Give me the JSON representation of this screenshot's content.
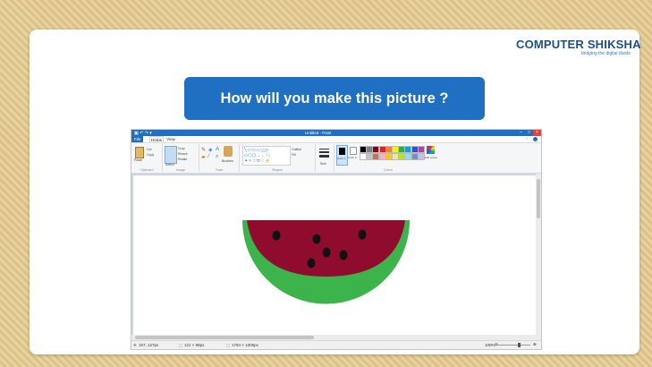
{
  "logo": {
    "main_a": "COMPUTER",
    "main_b": "SHIKSHA",
    "tagline": "bridging the digital divide"
  },
  "banner": {
    "question": "How will you make this picture ?"
  },
  "paint": {
    "title": "Untitled - Paint",
    "tabs": [
      "File",
      "Home",
      "View"
    ],
    "ribbon": {
      "paste_label": "Paste",
      "cut_label": "Cut",
      "copy_label": "Copy",
      "select_label": "Select",
      "crop_label": "Crop",
      "resize_label": "Resize",
      "rotate_label": "Rotate",
      "brushes_label": "Brushes",
      "outline_label": "Outline",
      "fill_label": "Fill",
      "size_label": "Size",
      "color1_label": "Color 1",
      "color2_label": "Color 2",
      "edit_colors_label": "Edit colors",
      "groups": [
        "Clipboard",
        "Image",
        "Tools",
        "Shapes",
        "Colors"
      ]
    },
    "palette": [
      "#000000",
      "#7f7f7f",
      "#880015",
      "#ed1c24",
      "#ff7f27",
      "#fff200",
      "#22b14c",
      "#00a2e8",
      "#3f48cc",
      "#a349a4",
      "#ffffff",
      "#c3c3c3",
      "#b97a57",
      "#ffaec9",
      "#ffc90e",
      "#efe4b0",
      "#b5e61d",
      "#99d9ea",
      "#7092be",
      "#c8bfe7"
    ],
    "status": {
      "cursor": "157, 127px",
      "selection": "121 × 98px",
      "size": "1794 × 1005px",
      "zoom": "100%"
    },
    "drawing": {
      "rind_color": "#3cb44b",
      "flesh_color": "#900c2e",
      "seed_color": "#111111",
      "seed_count": 6
    }
  }
}
